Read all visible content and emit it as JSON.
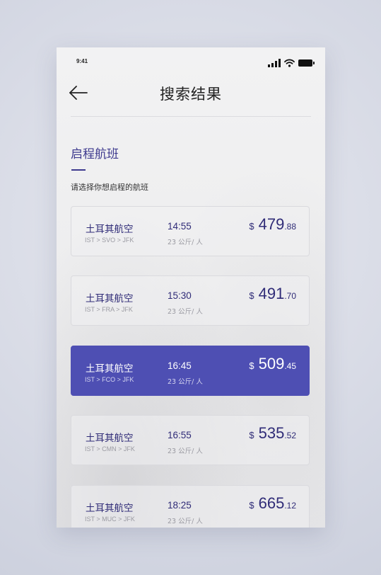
{
  "status_bar": {
    "time": "9:41"
  },
  "header": {
    "title": "搜索结果",
    "back_icon": "arrow-left-icon"
  },
  "section": {
    "title": "启程航班",
    "subtitle": "请选择你想启程的航班"
  },
  "colors": {
    "accent": "#4e4fb3",
    "text_primary": "#2f2b77",
    "text_secondary": "#9a9aa2"
  },
  "flights": [
    {
      "airline": "土耳其航空",
      "route": "IST > SVO > JFK",
      "time": "14:55",
      "distance": "23 公斤/ 人",
      "currency": "$",
      "price_int": "479",
      "price_dec": ".88",
      "selected": false
    },
    {
      "airline": "土耳其航空",
      "route": "IST > FRA > JFK",
      "time": "15:30",
      "distance": "23 公斤/ 人",
      "currency": "$",
      "price_int": "491",
      "price_dec": ".70",
      "selected": false
    },
    {
      "airline": "土耳其航空",
      "route": "IST > FCO > JFK",
      "time": "16:45",
      "distance": "23 公斤/ 人",
      "currency": "$",
      "price_int": "509",
      "price_dec": ".45",
      "selected": true
    },
    {
      "airline": "土耳其航空",
      "route": "IST > CMN > JFK",
      "time": "16:55",
      "distance": "23 公斤/ 人",
      "currency": "$",
      "price_int": "535",
      "price_dec": ".52",
      "selected": false
    },
    {
      "airline": "土耳其航空",
      "route": "IST > MUC > JFK",
      "time": "18:25",
      "distance": "23 公斤/ 人",
      "currency": "$",
      "price_int": "665",
      "price_dec": ".12",
      "selected": false
    }
  ]
}
